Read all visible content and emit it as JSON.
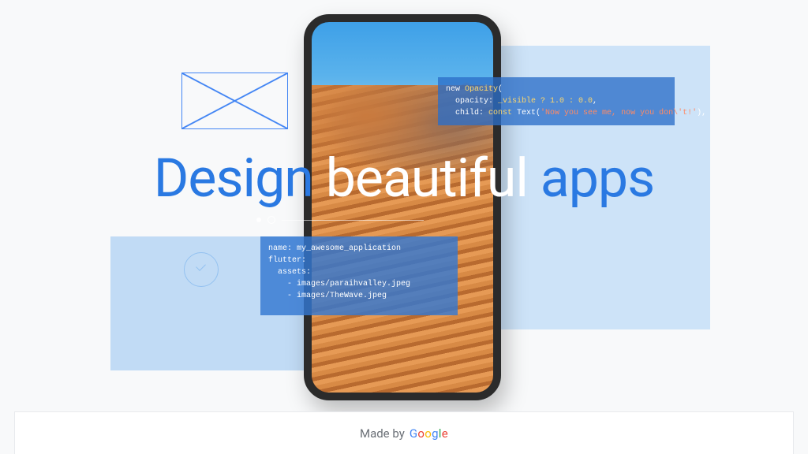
{
  "hero": {
    "headline_part1": "Design ",
    "headline_part2": "beautiful",
    "headline_part3": " apps"
  },
  "code_top": {
    "line1_a": "new ",
    "line1_b": "Opacity",
    "line1_c": "(",
    "line2_a": "  opacity: ",
    "line2_b": "_visible ? 1.0 : 0.0",
    "line2_c": ",",
    "line3_a": "  child: ",
    "line3_b": "const ",
    "line3_c": "Text(",
    "line3_d": "'Now you see me, now you don\\'t!'",
    "line3_e": "),"
  },
  "code_bottom": {
    "line1": "name: my_awesome_application",
    "line2": "flutter:",
    "line3": "  assets:",
    "line4": "    - images/paraihvalley.jpeg",
    "line5": "    - images/TheWave.jpeg"
  },
  "footer": {
    "prefix": "Made by ",
    "brand": "Google"
  }
}
